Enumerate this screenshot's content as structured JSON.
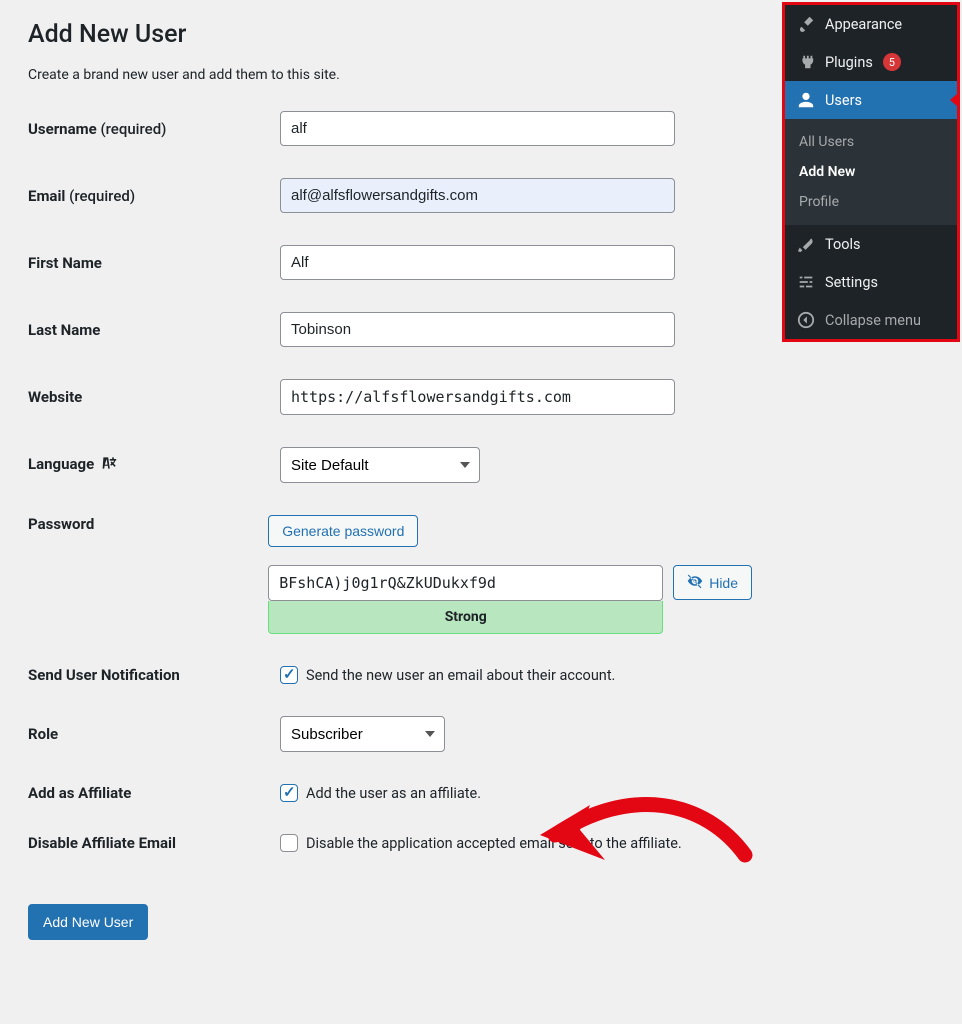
{
  "page": {
    "title": "Add New User",
    "intro": "Create a brand new user and add them to this site."
  },
  "form": {
    "username": {
      "label": "Username",
      "req": "(required)",
      "value": "alf"
    },
    "email": {
      "label": "Email",
      "req": "(required)",
      "value": "alf@alfsflowersandgifts.com"
    },
    "first_name": {
      "label": "First Name",
      "value": "Alf"
    },
    "last_name": {
      "label": "Last Name",
      "value": "Tobinson"
    },
    "website": {
      "label": "Website",
      "value": "https://alfsflowersandgifts.com"
    },
    "language": {
      "label": "Language",
      "selected": "Site Default"
    },
    "password": {
      "label": "Password",
      "generate_btn": "Generate password",
      "value": "BFshCA)j0g1rQ&ZkUDukxf9d",
      "strength": "Strong",
      "hide_btn": "Hide"
    },
    "notification": {
      "label": "Send User Notification",
      "text": "Send the new user an email about their account.",
      "checked": true
    },
    "role": {
      "label": "Role",
      "selected": "Subscriber"
    },
    "affiliate": {
      "label": "Add as Affiliate",
      "text": "Add the user as an affiliate.",
      "checked": true
    },
    "disable_email": {
      "label": "Disable Affiliate Email",
      "text": "Disable the application accepted email sent to the affiliate.",
      "checked": false
    },
    "submit": "Add New User"
  },
  "sidebar": {
    "appearance": "Appearance",
    "plugins": "Plugins",
    "plugins_count": "5",
    "users": "Users",
    "submenu": {
      "all": "All Users",
      "add": "Add New",
      "profile": "Profile"
    },
    "tools": "Tools",
    "settings": "Settings",
    "collapse": "Collapse menu"
  }
}
